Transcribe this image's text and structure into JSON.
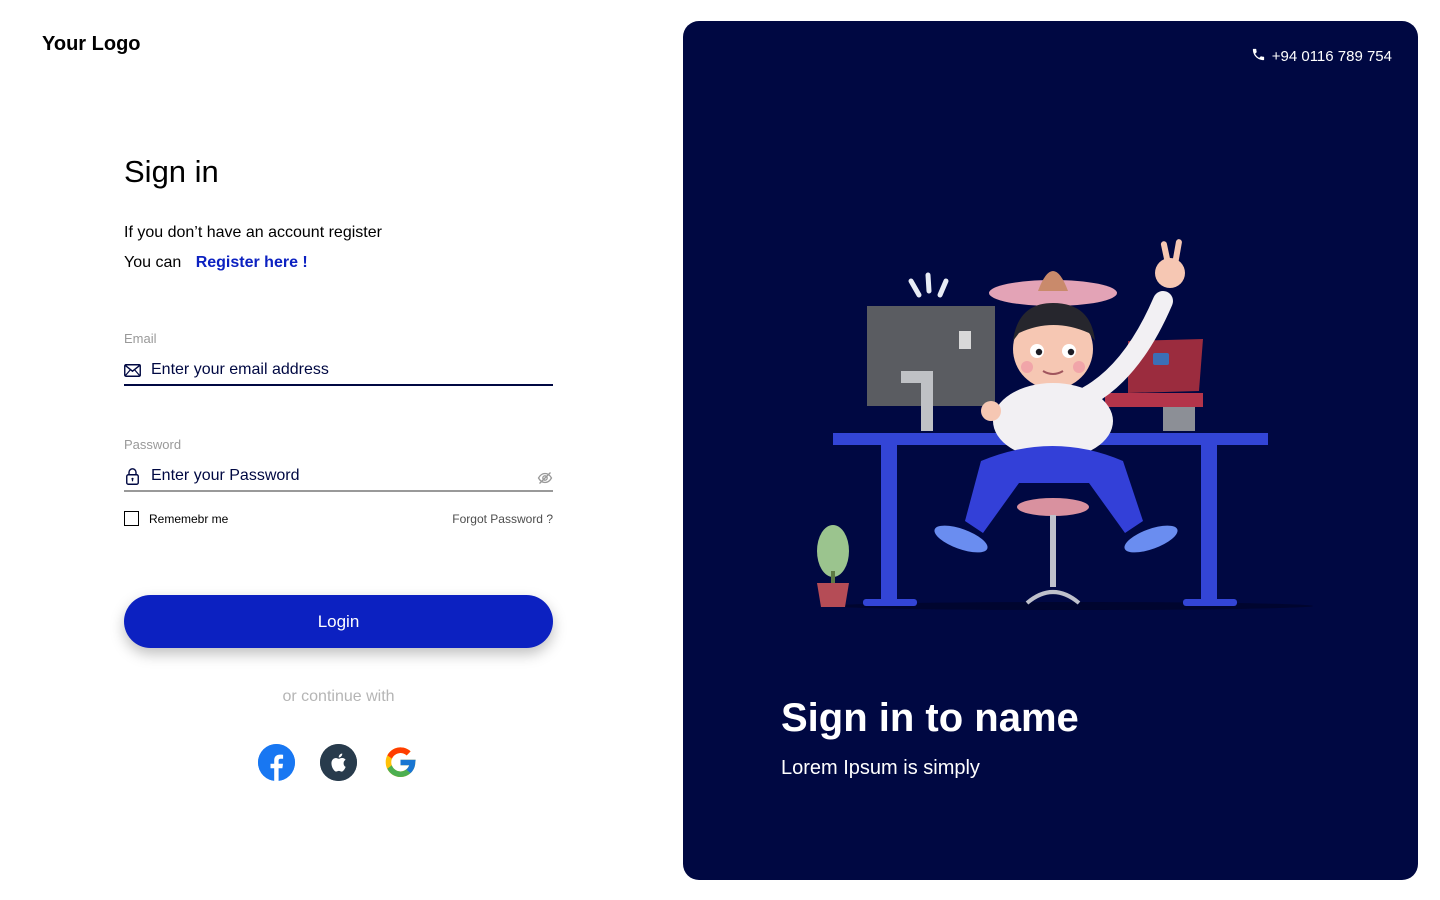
{
  "logo": "Your Logo",
  "signin": {
    "title": "Sign in",
    "line1": "If you don’t have an account register",
    "line2_prefix": "You can",
    "register_link": "Register here !"
  },
  "email": {
    "label": "Email",
    "placeholder": "Enter your email address",
    "icon": "envelope-icon"
  },
  "password": {
    "label": "Password",
    "placeholder": "Enter your Password",
    "icon": "lock-icon",
    "toggle_icon": "eye-off-icon"
  },
  "options": {
    "remember": "Rememebr me",
    "forgot": "Forgot Password ?"
  },
  "login_button": "Login",
  "or_continue": "or continue with",
  "socials": [
    {
      "name": "facebook-icon",
      "color": "#1877f2"
    },
    {
      "name": "apple-icon",
      "color": "#283b4c"
    },
    {
      "name": "google-icon",
      "color": "#ffffff"
    }
  ],
  "panel": {
    "phone": "+94 0116 789 754",
    "phone_icon": "phone-icon",
    "title": "Sign in to name",
    "subtitle": "Lorem Ipsum is simply",
    "background": "#000842"
  },
  "colors": {
    "accent": "#0c21c1",
    "navy": "#000842",
    "muted": "#999999"
  }
}
